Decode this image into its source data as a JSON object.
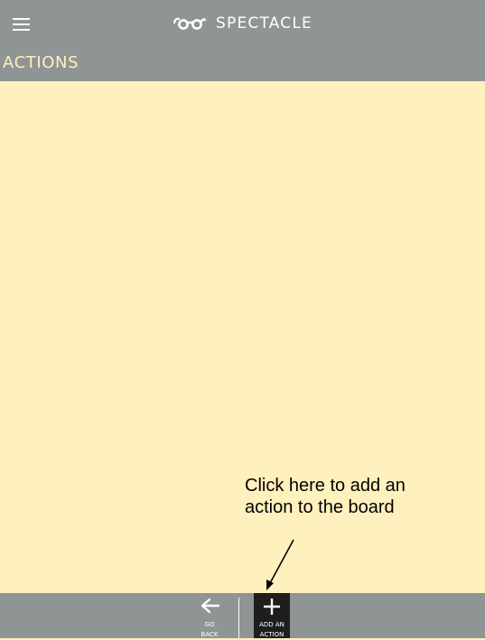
{
  "header": {
    "menu_icon": "hamburger-icon",
    "brand_icon": "spectacles-icon",
    "brand_name": "SPECTACLE",
    "section_title": "ACTIONS"
  },
  "board": {
    "callout_text": "Click here to add an action to the board"
  },
  "bottom_bar": {
    "go_back": {
      "icon": "arrow-left-icon",
      "label": "GO\nBACK"
    },
    "add_action": {
      "icon": "plus-icon",
      "label": "ADD AN\nACTION"
    }
  },
  "colors": {
    "bar_bg": "#8f9495",
    "board_bg": "#fff1bd",
    "title_accent": "#fff1bd",
    "active_button_bg": "#1e1e1e"
  }
}
